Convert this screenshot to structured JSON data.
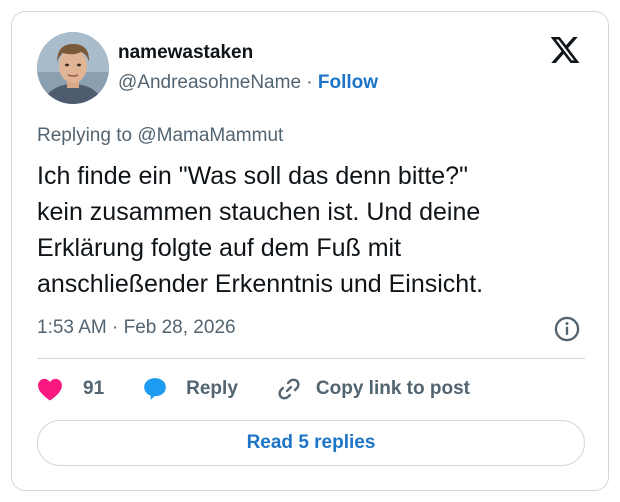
{
  "author": {
    "display_name": "namewastaken",
    "handle": "@AndreasohneName",
    "separator": "·",
    "follow_label": "Follow"
  },
  "reply_context": "Replying to @MamaMammut",
  "tweet": {
    "lines": [
      "Ich finde ein \"Was soll das denn bitte?\"",
      "kein zusammen stauchen ist. Und deine",
      "Erklärung folgte auf dem Fuß mit",
      "anschließender Erkenntnis und Einsicht."
    ],
    "timestamp": "1:53 AM · Feb 28, 2026"
  },
  "actions": {
    "like_count": "91",
    "reply_label": "Reply",
    "copy_link_label": "Copy link to post"
  },
  "read_replies_label": "Read 5 replies",
  "icons": {
    "logo": "x-logo-icon",
    "info": "info-icon",
    "like": "heart-icon",
    "reply": "speech-bubble-icon",
    "copy": "link-icon"
  },
  "colors": {
    "accent": "#1d75c7",
    "heart": "#f91880",
    "reply_bubble": "#1d9bf0",
    "secondary_text": "#536471",
    "border": "#cfd9de"
  }
}
